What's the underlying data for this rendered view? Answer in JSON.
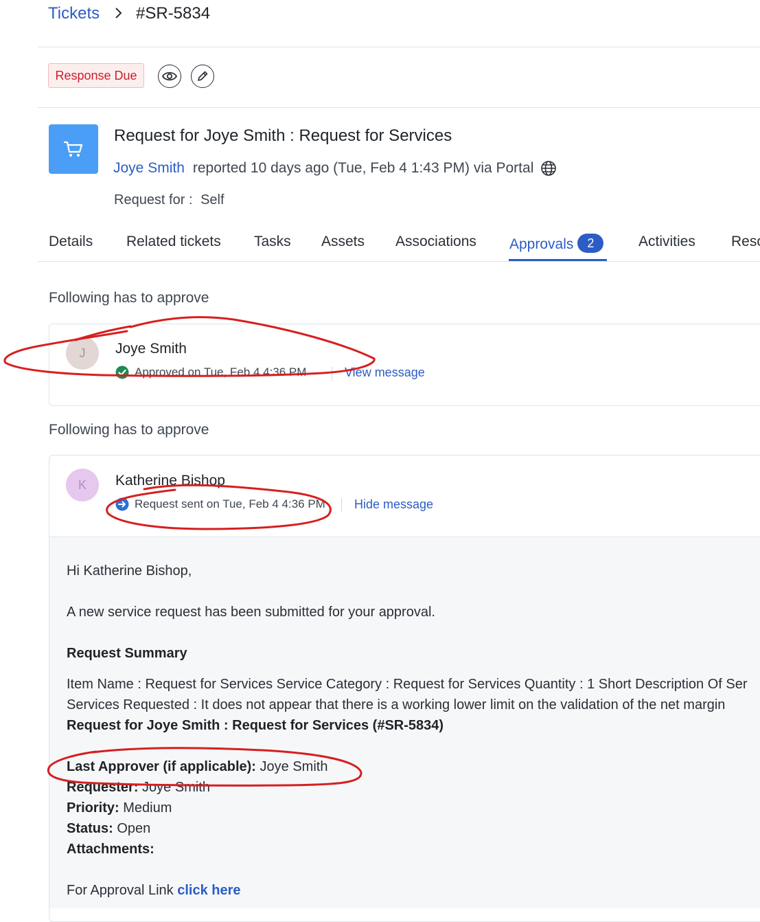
{
  "breadcrumb": {
    "root": "Tickets",
    "current": "#SR-5834"
  },
  "toolbar": {
    "status_badge": "Response Due"
  },
  "ticket": {
    "title": "Request for Joye Smith : Request for Services",
    "requester": "Joye Smith",
    "reported": "reported 10 days ago (Tue, Feb 4 1:43 PM) via Portal",
    "request_for_label": "Request for :",
    "request_for_value": "Self"
  },
  "tabs": [
    {
      "label": "Details"
    },
    {
      "label": "Related tickets"
    },
    {
      "label": "Tasks"
    },
    {
      "label": "Assets"
    },
    {
      "label": "Associations"
    },
    {
      "label": "Approvals",
      "count": "2",
      "active": true
    },
    {
      "label": "Activities"
    },
    {
      "label": "Reso"
    }
  ],
  "approvals": [
    {
      "heading": "Following has to approve",
      "initial": "J",
      "name": "Joye Smith",
      "status": "Approved on Tue, Feb 4 4:36 PM",
      "action": "View message"
    },
    {
      "heading": "Following has to approve",
      "initial": "K",
      "name": "Katherine Bishop",
      "status": "Request sent on Tue, Feb 4 4:36 PM",
      "action": "Hide message"
    }
  ],
  "message": {
    "greeting": "Hi Katherine Bishop,",
    "intro": "A new service request has been submitted for your approval.",
    "summary_heading": "Request Summary",
    "summary_line1": "Item Name : Request for Services Service Category : Request for Services Quantity : 1 Short Description Of Ser",
    "summary_line2": "Services Requested : It does not appear that there is a working lower limit on the validation of the net margin",
    "ticket_ref": "Request for Joye Smith : Request for Services (#SR-5834)",
    "fields": [
      {
        "label": "Last Approver (if applicable):",
        "value": "Joye Smith"
      },
      {
        "label": "Requester:",
        "value": "Joye Smith"
      },
      {
        "label": "Priority:",
        "value": "Medium"
      },
      {
        "label": "Status:",
        "value": "Open"
      },
      {
        "label": "Attachments:",
        "value": ""
      }
    ],
    "approval_text": "For Approval Link",
    "approval_link": "click here"
  },
  "colors": {
    "accent": "#2c5cc5",
    "annotation": "#d61f1f",
    "approved": "#1e8a56",
    "pending": "#2c6fd6"
  }
}
